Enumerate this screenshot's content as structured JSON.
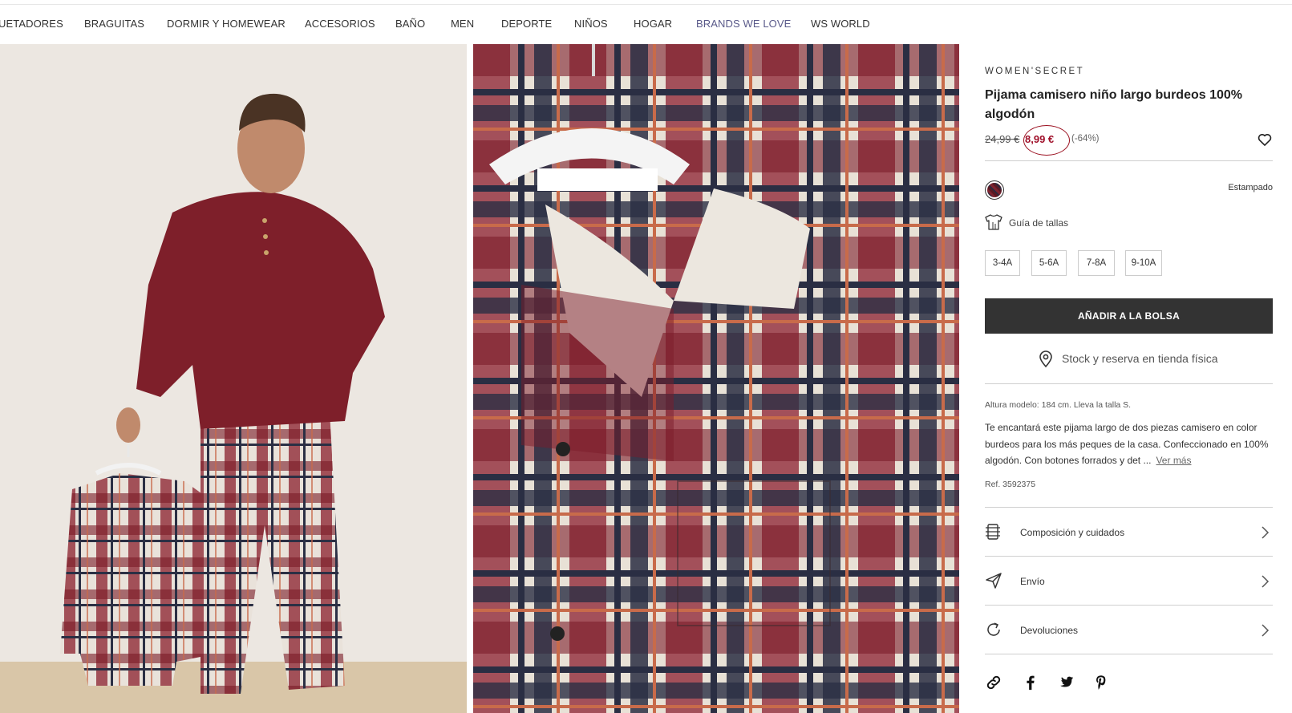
{
  "nav": {
    "items": [
      {
        "label": "UETADORES"
      },
      {
        "label": "BRAGUITAS"
      },
      {
        "label": "DORMIR Y HOMEWEAR"
      },
      {
        "label": "ACCESORIOS"
      },
      {
        "label": "BAÑO"
      },
      {
        "label": "MEN"
      },
      {
        "label": "DEPORTE"
      },
      {
        "label": "NIÑOS"
      },
      {
        "label": "HOGAR"
      },
      {
        "label": "BRANDS WE LOVE"
      },
      {
        "label": "WS WORLD"
      }
    ]
  },
  "gallery": {
    "images": [
      {
        "alt": "model-wearing-pajama",
        "icon": "photo"
      },
      {
        "alt": "plaid-shirt-on-hanger",
        "icon": "photo"
      }
    ]
  },
  "product": {
    "brand": "WOMEN'SECRET",
    "title": "Pijama camisero niño largo burdeos 100% algodón",
    "old_price": "24,99 €",
    "price": "8,99 €",
    "discount": "(-64%)",
    "color_name": "Estampado",
    "size_guide": "Guía de tallas",
    "sizes": [
      "3-4A",
      "5-6A",
      "7-8A",
      "9-10A"
    ],
    "add_to_bag": "AÑADIR A LA BOLSA",
    "stock_label": "Stock y reserva en tienda física",
    "model_info": "Altura modelo: 184 cm.  Lleva la talla S.",
    "description": "Te encantará este pijama largo de dos piezas camisero en color burdeos para los más peques de la casa. Confeccionado en 100% algodón. Con botones forrados y det ...",
    "see_more": "Ver más",
    "ref": "Ref. 3592375"
  },
  "accordion": [
    {
      "label": "Composición y cuidados",
      "icon": "care-label-icon"
    },
    {
      "label": "Envío",
      "icon": "send-icon"
    },
    {
      "label": "Devoluciones",
      "icon": "refresh-icon"
    }
  ],
  "colors": {
    "price_accent": "#a0102a",
    "button_bg": "#333333",
    "brand_link": "#5a5a8a"
  }
}
